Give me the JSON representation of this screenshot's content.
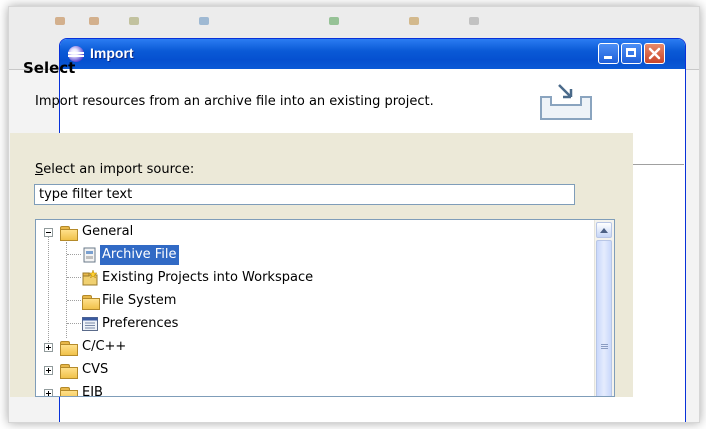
{
  "window": {
    "title": "Import",
    "controls": {
      "minimize": "minimize",
      "maximize": "maximize",
      "close": "close"
    }
  },
  "header": {
    "title": "Select",
    "description": "Import resources from an archive file into an existing project."
  },
  "source": {
    "label_prefix": "S",
    "label_rest": "elect an import source:",
    "filter_value": "type filter text"
  },
  "tree": {
    "items": [
      {
        "label": "General",
        "expanded": true,
        "icon": "folder-open-icon"
      },
      {
        "label": "Archive File",
        "selected": true,
        "icon": "archive-file-icon"
      },
      {
        "label": "Existing Projects into Workspace",
        "icon": "project-icon"
      },
      {
        "label": "File System",
        "icon": "folder-icon"
      },
      {
        "label": "Preferences",
        "icon": "preferences-icon"
      },
      {
        "label": "C/C++",
        "expanded": false,
        "icon": "folder-icon"
      },
      {
        "label": "CVS",
        "expanded": false,
        "icon": "folder-icon"
      },
      {
        "label": "EJB",
        "expanded": false,
        "icon": "folder-icon"
      }
    ]
  },
  "colors": {
    "title_bar": "#0a5ad6",
    "selection": "#316ac5",
    "dialog_body": "#ece9d8"
  }
}
